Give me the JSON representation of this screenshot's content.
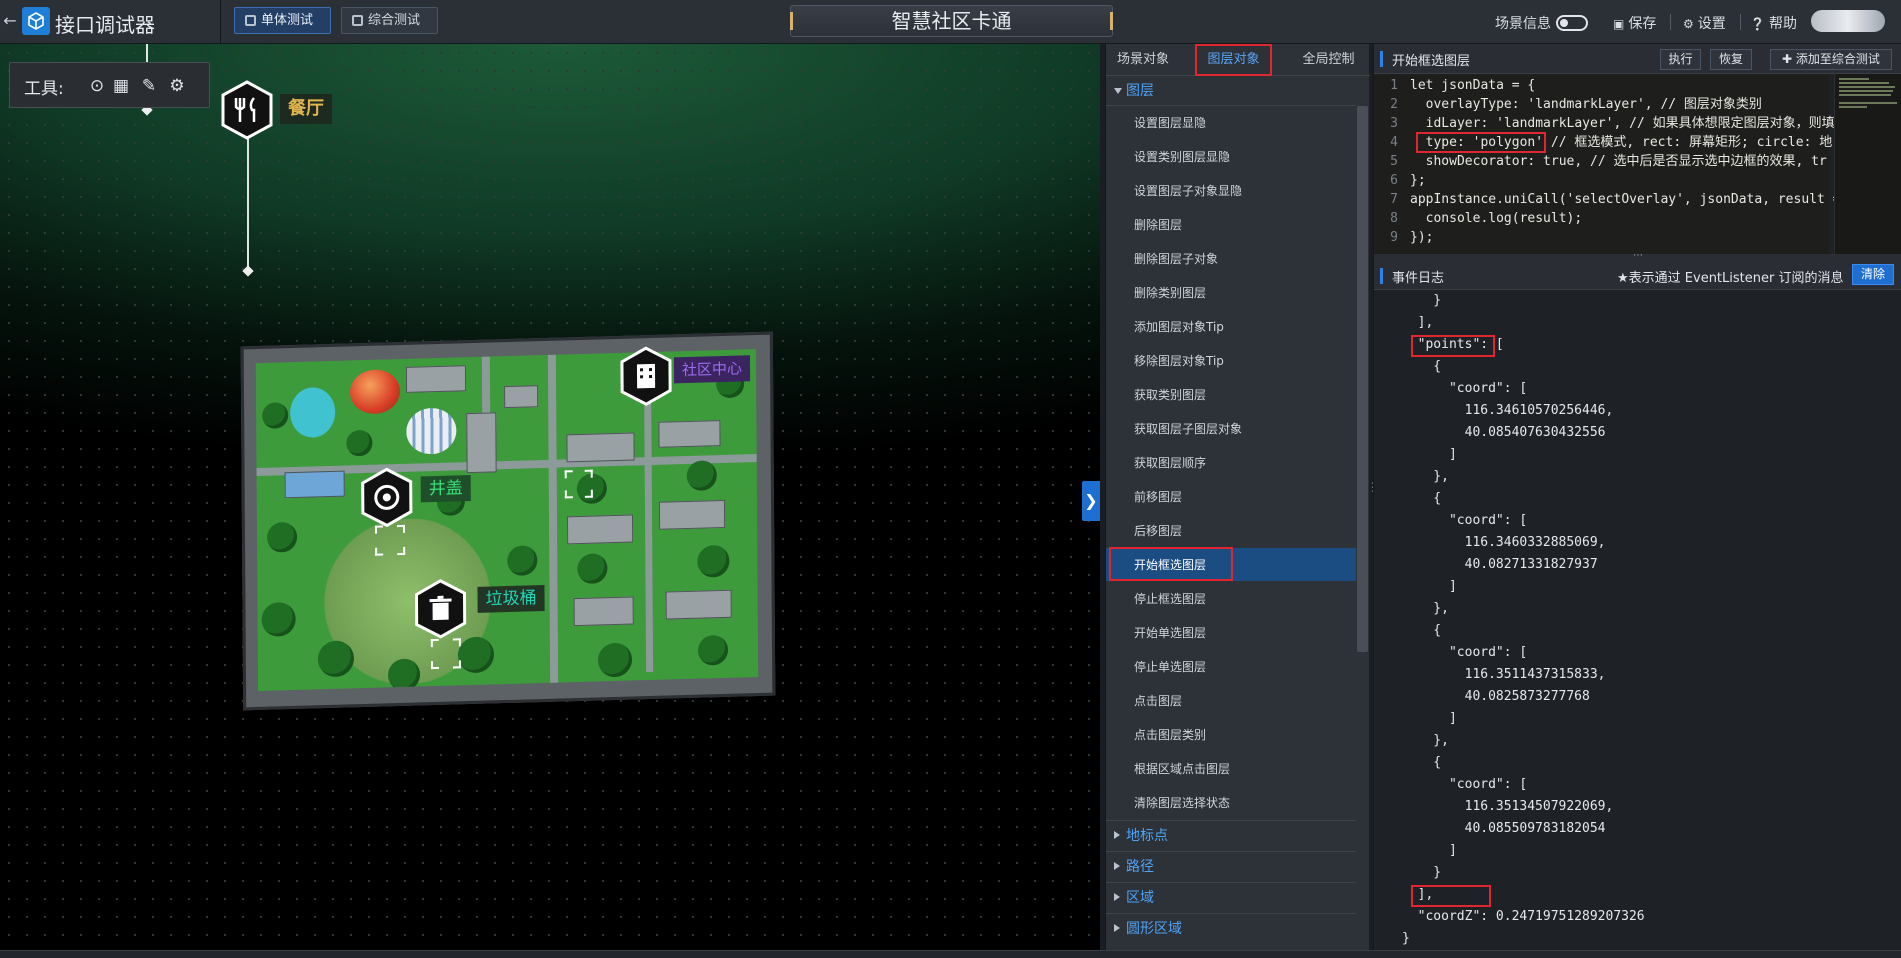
{
  "app": {
    "back_icon": "arrow-left-icon",
    "logo_icon": "cube-logo-icon",
    "title": "接口调试器"
  },
  "top_tabs": {
    "single": "单体测试",
    "multi": "综合测试"
  },
  "scene_title": "智慧社区卡通",
  "top_right": {
    "scene_info": "场景信息",
    "save": "保存",
    "settings": "设置",
    "help": "帮助"
  },
  "toolbox": {
    "label": "工具:"
  },
  "pins": {
    "restaurant": "餐厅",
    "manhole": "井盖",
    "trash": "垃圾桶",
    "building": "社区中心"
  },
  "mid_tabs": {
    "scene": "场景对象",
    "layer": "图层对象",
    "global": "全局控制"
  },
  "layer_section": "图层",
  "menu_items": [
    "设置图层显隐",
    "设置类别图层显隐",
    "设置图层子对象显隐",
    "删除图层",
    "删除图层子对象",
    "删除类别图层",
    "添加图层对象Tip",
    "移除图层对象Tip",
    "获取类别图层",
    "获取图层子图层对象",
    "获取图层顺序",
    "前移图层",
    "后移图层",
    "开始框选图层",
    "停止框选图层",
    "开始单选图层",
    "停止单选图层",
    "点击图层",
    "点击图层类别",
    "根据区域点击图层",
    "清除图层选择状态"
  ],
  "sub_sections": [
    "地标点",
    "路径",
    "区域",
    "圆形区域"
  ],
  "code_panel": {
    "title": "开始框选图层",
    "exec": "执行",
    "restore": "恢复",
    "add": "添加至综合测试"
  },
  "code_lines": [
    {
      "n": "1",
      "t": "let jsonData = {"
    },
    {
      "n": "2",
      "t": "  overlayType: 'landmarkLayer', // 图层对象类别"
    },
    {
      "n": "3",
      "t": "  idLayer: 'landmarkLayer', // 如果具体想限定图层对象，则填"
    },
    {
      "n": "4",
      "t": "  type: 'polygon' // 框选模式, rect: 屏幕矩形; circle: 地"
    },
    {
      "n": "5",
      "t": "  showDecorator: true, // 选中后是否显示选中边框的效果, tr"
    },
    {
      "n": "6",
      "t": "};"
    },
    {
      "n": "7",
      "t": "appInstance.uniCall('selectOverlay', jsonData, result =>"
    },
    {
      "n": "8",
      "t": "  console.log(result);"
    },
    {
      "n": "9",
      "t": "});"
    }
  ],
  "log_panel": {
    "title": "事件日志",
    "note": "★表示通过 EventListener 订阅的消息",
    "clear": "清除"
  },
  "log_lines": [
    "    }",
    "  ],",
    "  \"points\": [",
    "    {",
    "      \"coord\": [",
    "        116.34610570256446,",
    "        40.085407630432556",
    "      ]",
    "    },",
    "    {",
    "      \"coord\": [",
    "        116.3460332885069,",
    "        40.08271331827937",
    "      ]",
    "    },",
    "    {",
    "      \"coord\": [",
    "        116.3511437315833,",
    "        40.0825873277768",
    "      ]",
    "    },",
    "    {",
    "      \"coord\": [",
    "        116.35134507922069,",
    "        40.085509783182054",
    "      ]",
    "    }",
    "  ],",
    "  \"coordZ\": 0.24719751289207326",
    "}"
  ]
}
